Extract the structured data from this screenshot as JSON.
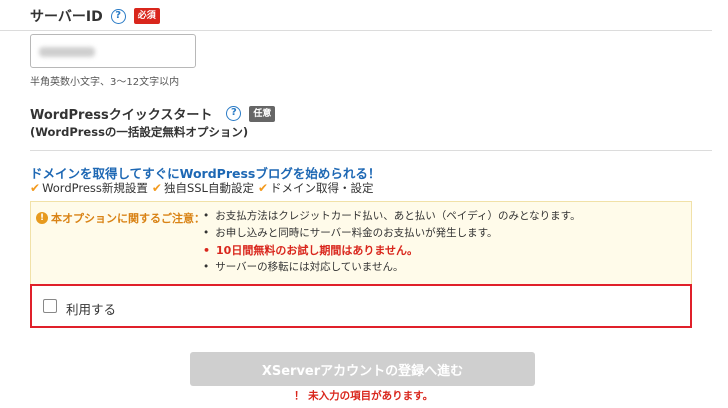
{
  "server_id": {
    "label": "サーバーID",
    "help": "?",
    "required_badge": "必須",
    "hint": "半角英数小文字、3〜12文字以内"
  },
  "wp_quick": {
    "label": "WordPressクイックスタート",
    "help": "?",
    "optional_badge": "任意",
    "sub": "(WordPressの一括設定無料オプション)"
  },
  "promo": {
    "headline": "ドメインを取得してすぐにWordPressブログを始められる！",
    "features": [
      {
        "check": "✔",
        "label": "WordPress新規設置"
      },
      {
        "check": "✔",
        "label": "独自SSL自動設定"
      },
      {
        "check": "✔",
        "label": "ドメイン取得・設定"
      }
    ]
  },
  "notice": {
    "icon": "!",
    "title": "本オプションに関するご注意：",
    "bullet": "•",
    "items": [
      "お支払方法はクレジットカード払い、あと払い（ペイディ）のみとなります。",
      "お申し込みと同時にサーバー料金のお支払いが発生します。",
      "10日間無料のお試し期間はありません。",
      "サーバーの移転には対応していません。"
    ]
  },
  "option": {
    "label": "利用する",
    "checked": false
  },
  "submit": {
    "label": "XServerアカウントの登録へ進む"
  },
  "error": {
    "text": "！ 未入力の項目があります。"
  },
  "colors": {
    "accent_red": "#e0202a",
    "link_blue": "#1e68b4",
    "warn_orange": "#d98316"
  }
}
